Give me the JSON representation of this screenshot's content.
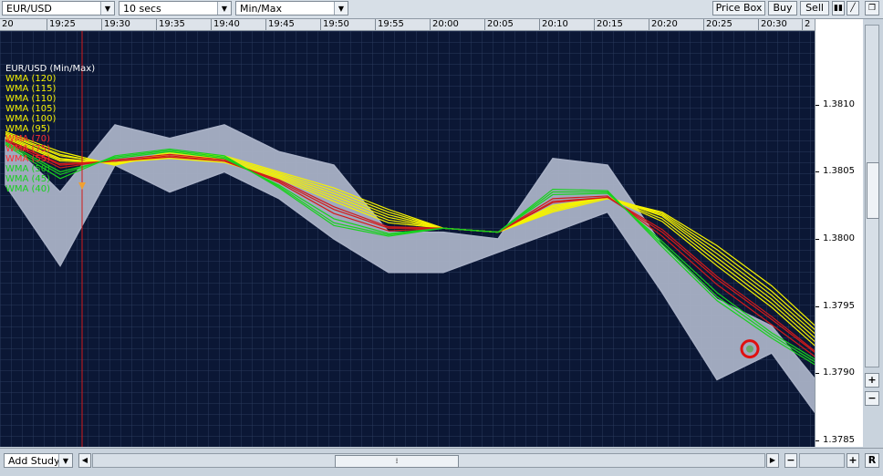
{
  "toolbar": {
    "symbol": "EUR/USD",
    "interval": "10 secs",
    "style": "Min/Max",
    "price_box_label": "Price Box",
    "buy_label": "Buy",
    "sell_label": "Sell"
  },
  "bottom": {
    "add_study_label": "Add Study",
    "scroll_left": "◀",
    "scroll_right": "▶",
    "zoom_out": "−",
    "zoom_in": "+",
    "reset": "R"
  },
  "right_controls": {
    "plus": "+",
    "minus": "−"
  },
  "colors": {
    "background": "#0b1735",
    "grid": "#2a3a5c",
    "price_band": "#a9b1c6",
    "wma_yellow": "#f5f200",
    "wma_red": "#d21a1a",
    "wma_green": "#19d11e",
    "crosshair": "#d21a1a",
    "marker": "#e01010"
  },
  "chart_data": {
    "type": "line",
    "title": "EUR/USD (Min/Max)",
    "x_ticks": [
      "20",
      "19:25",
      "19:30",
      "19:35",
      "19:40",
      "19:45",
      "19:50",
      "19:55",
      "20:00",
      "20:05",
      "20:10",
      "20:15",
      "20:20",
      "20:25",
      "20:30",
      "2"
    ],
    "y_ticks": [
      "1.3810",
      "1.3805",
      "1.3800",
      "1.3795",
      "1.3790",
      "1.3785"
    ],
    "ylim": [
      1.37845,
      1.38155
    ],
    "x_minutes": [
      0,
      5,
      10,
      15,
      20,
      25,
      30,
      35,
      40,
      45,
      50,
      55,
      60,
      65,
      70,
      74
    ],
    "series": [
      {
        "name": "Min/Max band",
        "upper": [
          1.38075,
          1.38035,
          1.38085,
          1.38075,
          1.38085,
          1.38065,
          1.38055,
          1.38005,
          1.38005,
          1.38,
          1.3806,
          1.38055,
          1.37995,
          1.37955,
          1.37935,
          1.37895
        ],
        "lower": [
          1.3804,
          1.3798,
          1.38055,
          1.38035,
          1.3805,
          1.3803,
          1.38,
          1.37975,
          1.37975,
          1.3799,
          1.38005,
          1.3802,
          1.3796,
          1.37895,
          1.37915,
          1.3787
        ]
      }
    ],
    "wma": [
      {
        "name": "WMA (120)",
        "color": "#f5f200",
        "values": [
          1.3808,
          1.38065,
          1.38055,
          1.38065,
          1.38062,
          1.3805,
          1.38038,
          1.38022,
          1.38008,
          1.38005,
          1.3802,
          1.3803,
          1.3802,
          1.37995,
          1.37965,
          1.37935
        ]
      },
      {
        "name": "WMA (115)",
        "color": "#f5f200",
        "values": [
          1.38079,
          1.38063,
          1.38055,
          1.38064,
          1.38061,
          1.38049,
          1.38036,
          1.3802,
          1.38008,
          1.38005,
          1.38021,
          1.38031,
          1.38019,
          1.37992,
          1.37961,
          1.37932
        ]
      },
      {
        "name": "WMA (110)",
        "color": "#f5f200",
        "values": [
          1.38078,
          1.38062,
          1.38056,
          1.38063,
          1.3806,
          1.38048,
          1.38034,
          1.38018,
          1.38008,
          1.38005,
          1.38022,
          1.38031,
          1.38018,
          1.37989,
          1.37958,
          1.37929
        ]
      },
      {
        "name": "WMA (105)",
        "color": "#f5f200",
        "values": [
          1.38077,
          1.3806,
          1.38056,
          1.38062,
          1.38059,
          1.38047,
          1.38032,
          1.38016,
          1.38008,
          1.38005,
          1.38023,
          1.38031,
          1.38017,
          1.37986,
          1.37955,
          1.37926
        ]
      },
      {
        "name": "WMA (100)",
        "color": "#f5f200",
        "values": [
          1.38076,
          1.38059,
          1.38057,
          1.38061,
          1.38058,
          1.38046,
          1.3803,
          1.38014,
          1.38008,
          1.38005,
          1.38024,
          1.38031,
          1.38015,
          1.37983,
          1.37952,
          1.37923
        ]
      },
      {
        "name": "WMA (95)",
        "color": "#f5f200",
        "values": [
          1.38075,
          1.38058,
          1.38057,
          1.3806,
          1.38057,
          1.38045,
          1.38028,
          1.38012,
          1.38008,
          1.38005,
          1.38025,
          1.38031,
          1.38013,
          1.3798,
          1.37949,
          1.3792
        ]
      },
      {
        "name": "WMA (70)",
        "color": "#d21a1a",
        "values": [
          1.38074,
          1.38055,
          1.38058,
          1.38062,
          1.38058,
          1.38043,
          1.38022,
          1.38008,
          1.38008,
          1.38005,
          1.38028,
          1.38031,
          1.38005,
          1.3797,
          1.3794,
          1.37915
        ]
      },
      {
        "name": "WMA (75)",
        "color": "#d21a1a",
        "values": [
          1.38074,
          1.38056,
          1.38058,
          1.38061,
          1.38058,
          1.38044,
          1.38024,
          1.38009,
          1.38008,
          1.38005,
          1.38027,
          1.38031,
          1.38007,
          1.37972,
          1.37942,
          1.37916
        ]
      },
      {
        "name": "WMA (55)",
        "color": "#d21a1a",
        "values": [
          1.38073,
          1.38053,
          1.38059,
          1.38063,
          1.38059,
          1.38042,
          1.38019,
          1.38006,
          1.38008,
          1.38005,
          1.3803,
          1.38032,
          1.38002,
          1.37966,
          1.37936,
          1.37912
        ]
      },
      {
        "name": "WMA (50)",
        "color": "#19d11e",
        "values": [
          1.38072,
          1.3805,
          1.3806,
          1.38065,
          1.3806,
          1.3804,
          1.38015,
          1.38004,
          1.38008,
          1.38005,
          1.38033,
          1.38034,
          1.37998,
          1.3796,
          1.3793,
          1.3791
        ]
      },
      {
        "name": "WMA (45)",
        "color": "#19d11e",
        "values": [
          1.38071,
          1.38048,
          1.38061,
          1.38066,
          1.38061,
          1.38039,
          1.38012,
          1.38003,
          1.38008,
          1.38005,
          1.38035,
          1.38035,
          1.37996,
          1.37957,
          1.37928,
          1.37908
        ]
      },
      {
        "name": "WMA (40)",
        "color": "#19d11e",
        "values": [
          1.3807,
          1.38045,
          1.38062,
          1.38067,
          1.38062,
          1.38038,
          1.3801,
          1.38002,
          1.38008,
          1.38005,
          1.38037,
          1.38036,
          1.37994,
          1.37954,
          1.37926,
          1.37906
        ]
      }
    ],
    "legend": [
      "EUR/USD (Min/Max)",
      "WMA (120)",
      "WMA (115)",
      "WMA (110)",
      "WMA (105)",
      "WMA (100)",
      "WMA (95)",
      "WMA (70)",
      "WMA (75)",
      "WMA (55)",
      "WMA (50)",
      "WMA (45)",
      "WMA (40)"
    ],
    "crosshair_minute": 7,
    "marker": {
      "minute": 68,
      "price": 1.37918
    },
    "grid": true
  }
}
